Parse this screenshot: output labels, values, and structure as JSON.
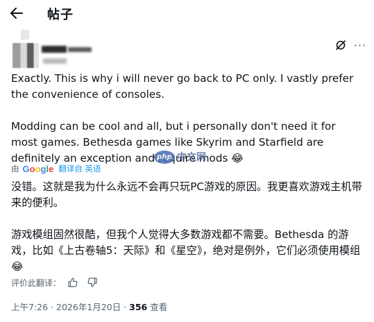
{
  "header": {
    "title": "帖子",
    "back_icon": "arrow-left-icon"
  },
  "post": {
    "paragraphs": [
      "Exactly. This is why i will never go back to PC only. I vastly prefer the convenience of consoles.",
      "Modding can be cool and all, but i personally don't need it for most games. Bethesda games like Skyrim and Starfield are definitely an exception and require mods"
    ],
    "emoji": "😂"
  },
  "translation": {
    "by_label": "由",
    "provider": "Google",
    "action_label": "翻译自 英语",
    "paragraphs": [
      "没错。这就是我为什么永远不会再只玩PC游戏的原因。我更喜欢游戏主机带来的便利。",
      "游戏模组固然很酷，但我个人觉得大多数游戏都不需要。Bethesda 的游戏，比如《上古卷轴5：天际》和《星空》，绝对是例外，它们必须使用模组"
    ],
    "emoji": "😂",
    "rate_label": "评价此翻译："
  },
  "meta": {
    "time": "上午7:26",
    "date": "2026年1月20日",
    "separator": "·",
    "views_count": "356",
    "views_label": "查看"
  },
  "watermark": {
    "logo_text": "php",
    "text": "中文网"
  },
  "colors": {
    "accent": "#1d9bf0",
    "secondary_text": "#536471",
    "primary_text": "#0f1419"
  }
}
